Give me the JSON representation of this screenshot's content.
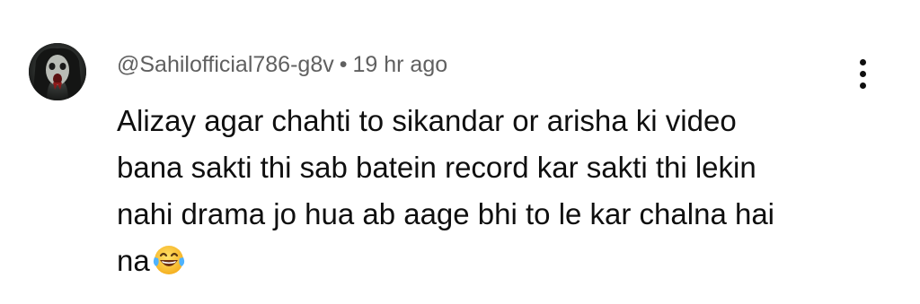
{
  "comment": {
    "author": "@Sahilofficial786-g8v",
    "separator": "•",
    "timestamp": "19 hr ago",
    "lines": [
      "Alizay agar chahti to sikandar or arisha ki video",
      "bana sakti thi sab batein record kar sakti thi lekin",
      "nahi drama jo hua ab aage bhi to le kar chalna hai",
      "na"
    ],
    "emoji": "face-with-tears-of-joy",
    "avatar_icon": "avatar-horror-face",
    "menu_icon": "more-vertical-icon"
  }
}
